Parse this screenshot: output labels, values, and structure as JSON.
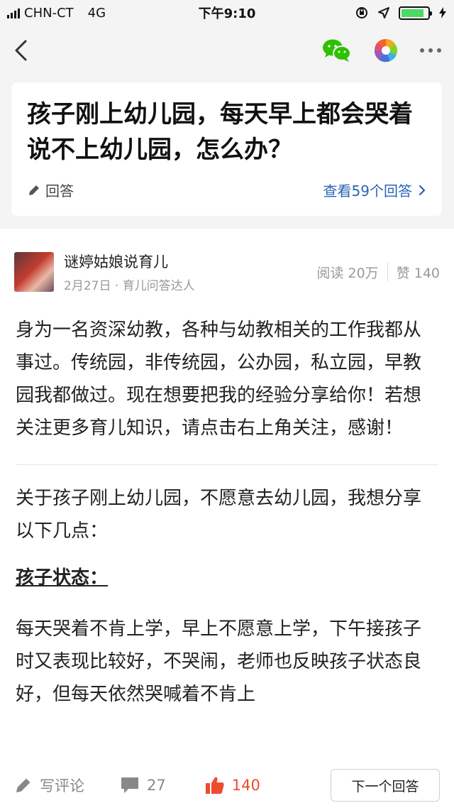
{
  "status_bar": {
    "carrier": "CHN-CT",
    "network": "4G",
    "time": "下午9:10",
    "battery_level": 0.85
  },
  "nav": {
    "back_icon": "chevron-left-icon",
    "share_wechat_icon": "wechat-icon",
    "share_moments_icon": "moments-icon",
    "more_icon": "more-dots-icon"
  },
  "question": {
    "title": "孩子刚上幼儿园，每天早上都会哭着说不上幼儿园，怎么办？",
    "answer_label": "回答",
    "view_all_label": "查看59个回答"
  },
  "author": {
    "name": "谜婷姑娘说育儿",
    "meta": "2月27日 · 育儿问答达人",
    "reads": "阅读 20万",
    "likes": "赞 140"
  },
  "article": {
    "intro": "身为一名资深幼教，各种与幼教相关的工作我都从事过。传统园，非传统园，公办园，私立园，早教园我都做过。现在想要把我的经验分享给你！若想关注更多育儿知识，请点击右上角关注，感谢！",
    "para1": "关于孩子刚上幼儿园，不愿意去幼儿园，我想分享以下几点：",
    "heading1": "孩子状态：",
    "para2": "每天哭着不肯上学，早上不愿意上学，下午接孩子时又表现比较好，不哭闹，老师也反映孩子状态良好，但每天依然哭喊着不肯上"
  },
  "bottom_bar": {
    "comment_placeholder": "写评论",
    "comment_count": "27",
    "like_count": "140",
    "next_label": "下一个回答"
  },
  "colors": {
    "link": "#2a64b3",
    "like": "#f04a2e",
    "wechat": "#2dc100"
  }
}
